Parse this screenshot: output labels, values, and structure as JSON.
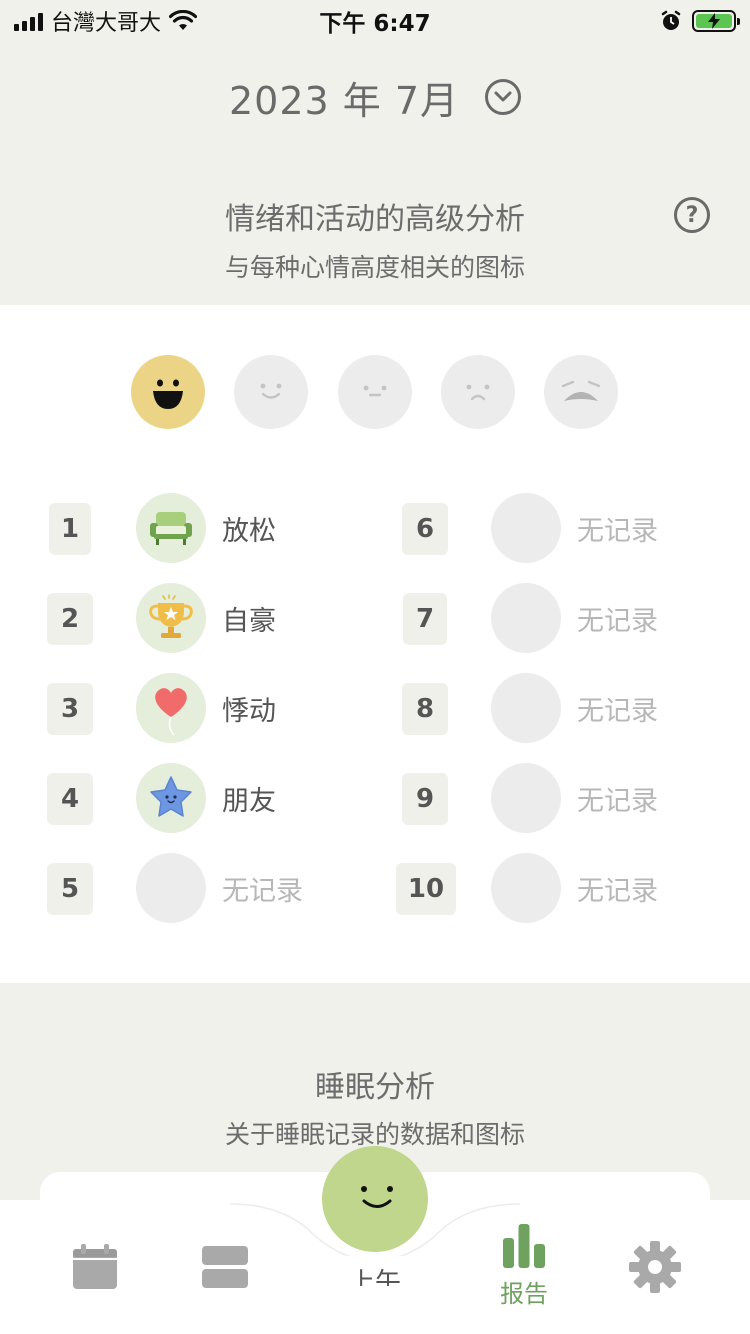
{
  "status_bar": {
    "carrier": "台灣大哥大",
    "time": "下午 6:47"
  },
  "header": {
    "month": "2023 年 7月"
  },
  "emotion_section": {
    "title": "情绪和活动的高级分析",
    "subtitle": "与每种心情高度相关的图标"
  },
  "moods": [
    {
      "name": "great",
      "selected": true
    },
    {
      "name": "good",
      "selected": false
    },
    {
      "name": "meh",
      "selected": false
    },
    {
      "name": "bad",
      "selected": false
    },
    {
      "name": "awful",
      "selected": false
    }
  ],
  "ranking": [
    {
      "rank": "1",
      "label": "放松",
      "icon": "sofa-icon"
    },
    {
      "rank": "2",
      "label": "自豪",
      "icon": "trophy-icon"
    },
    {
      "rank": "3",
      "label": "悸动",
      "icon": "heart-balloon-icon"
    },
    {
      "rank": "4",
      "label": "朋友",
      "icon": "star-friend-icon"
    },
    {
      "rank": "5",
      "label": "无记录",
      "icon": null
    },
    {
      "rank": "6",
      "label": "无记录",
      "icon": null
    },
    {
      "rank": "7",
      "label": "无记录",
      "icon": null
    },
    {
      "rank": "8",
      "label": "无记录",
      "icon": null
    },
    {
      "rank": "9",
      "label": "无记录",
      "icon": null
    },
    {
      "rank": "10",
      "label": "无记录",
      "icon": null
    }
  ],
  "sleep_section": {
    "title": "睡眠分析",
    "subtitle": "关于睡眠记录的数据和图标"
  },
  "tab_bar": {
    "calendar_icon": "calendar-icon",
    "entries_icon": "entries-icon",
    "center_label": "上午",
    "report_label": "报告",
    "settings_icon": "gear-icon",
    "active_color": "#6ea25e"
  },
  "colors": {
    "background": "#f1f1ec",
    "card": "#ffffff",
    "mood_great": "#ebd486",
    "mood_inactive": "#ececec",
    "center_button": "#bfd68c",
    "empty_text": "#b7b7b7"
  }
}
